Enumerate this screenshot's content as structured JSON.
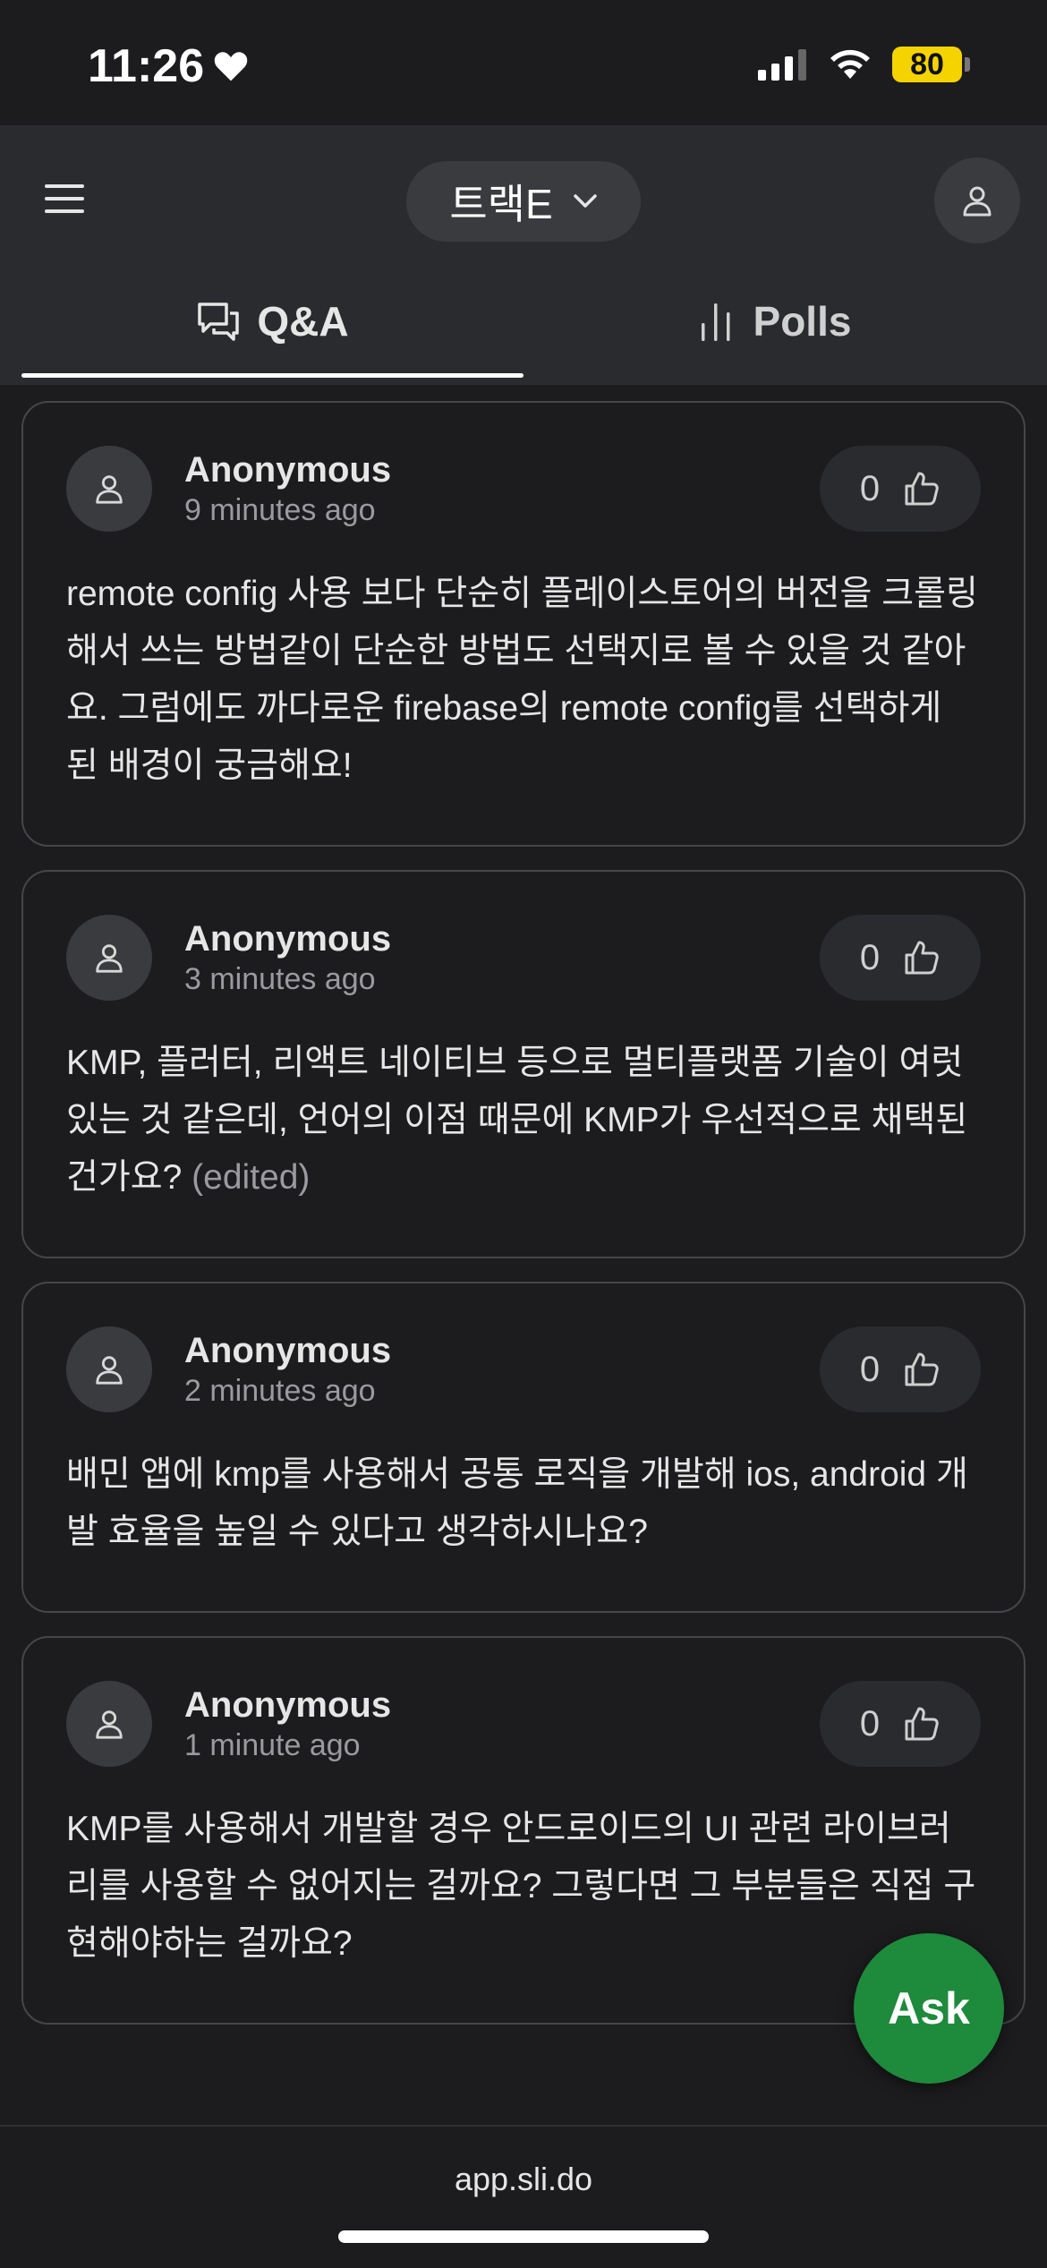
{
  "status_bar": {
    "time": "11:26",
    "battery": "80"
  },
  "header": {
    "track_label": "트랙E"
  },
  "tabs": [
    {
      "label": "Q&A",
      "active": true
    },
    {
      "label": "Polls",
      "active": false
    }
  ],
  "questions": [
    {
      "author": "Anonymous",
      "time": "9 minutes ago",
      "likes": "0",
      "text": "remote config 사용 보다 단순히 플레이스토어의 버전을 크롤링 해서 쓰는 방법같이 단순한 방법도 선택지로 볼 수 있을 것 같아요. 그럼에도 까다로운 firebase의 remote config를 선택하게 된 배경이 궁금해요!",
      "edited": ""
    },
    {
      "author": "Anonymous",
      "time": "3 minutes ago",
      "likes": "0",
      "text": "KMP, 플러터, 리액트 네이티브 등으로 멀티플랫폼 기술이 여럿 있는 것 같은데, 언어의 이점 때문에 KMP가 우선적으로 채택된 건가요? ",
      "edited": "(edited)"
    },
    {
      "author": "Anonymous",
      "time": "2 minutes ago",
      "likes": "0",
      "text": "배민 앱에 kmp를 사용해서 공통 로직을 개발해 ios, android 개발 효율을 높일 수 있다고 생각하시나요?",
      "edited": ""
    },
    {
      "author": "Anonymous",
      "time": "1 minute ago",
      "likes": "0",
      "text": "KMP를 사용해서 개발할 경우 안드로이드의 UI 관련 라이브러리를 사용할 수 없어지는 걸까요? 그렇다면 그 부분들은 직접 구현해야하는 걸까요?",
      "edited": ""
    }
  ],
  "ask_button": {
    "label": "Ask"
  },
  "browser": {
    "url": "app.sli.do"
  }
}
